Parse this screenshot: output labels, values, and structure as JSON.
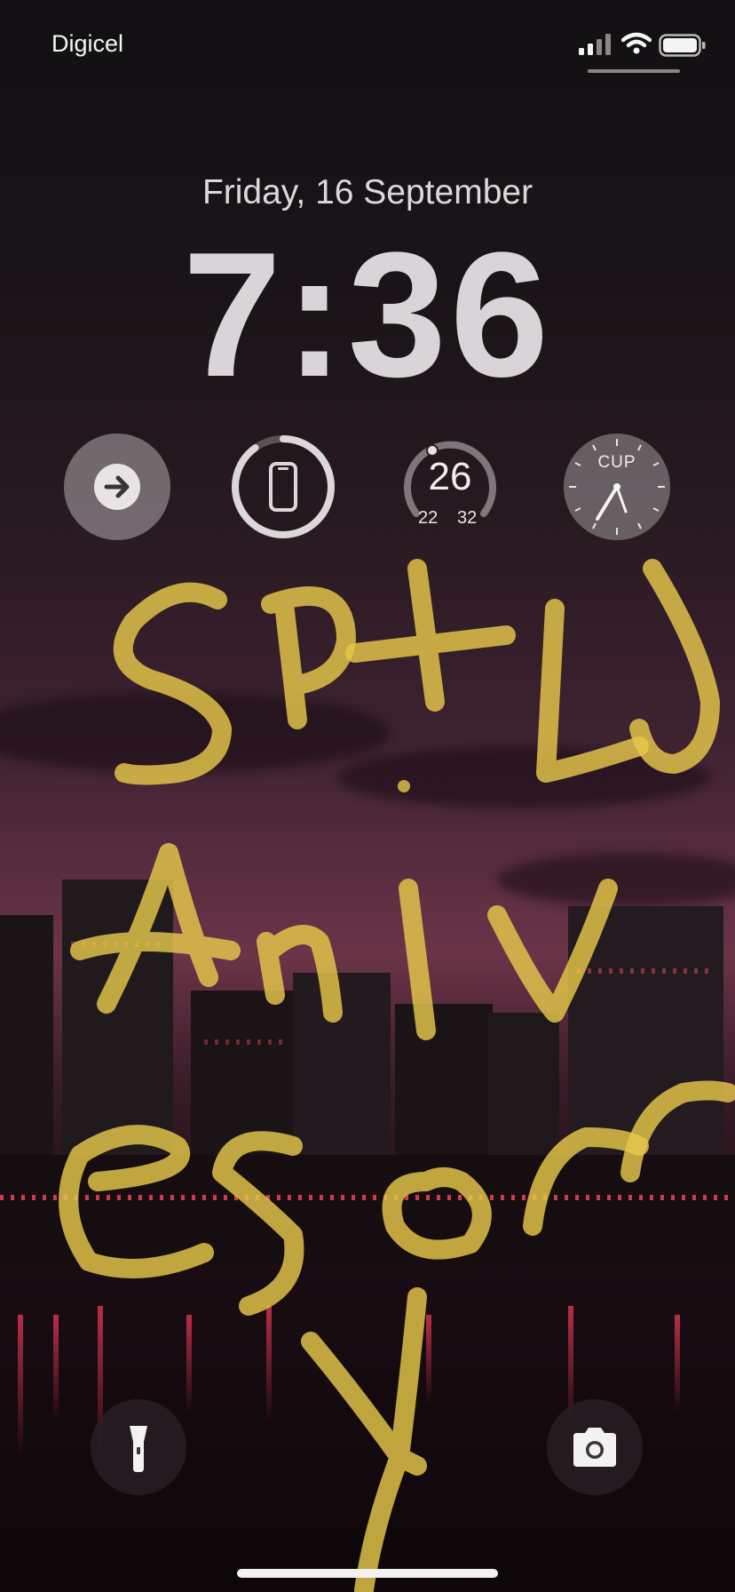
{
  "status_bar": {
    "carrier": "Digicel",
    "signal_icon": "cellular-signal-icon",
    "wifi_icon": "wifi-icon",
    "battery_icon": "battery-icon"
  },
  "lock_screen": {
    "date": "Friday, 16 September",
    "time": "7:36"
  },
  "widgets": {
    "shortcut": {
      "icon": "arrow-right-icon"
    },
    "battery": {
      "icon": "phone-icon",
      "level_fraction": 0.9
    },
    "weather": {
      "current": "26",
      "low": "22",
      "high": "32"
    },
    "clock": {
      "label": "CUP"
    }
  },
  "quick_actions": {
    "flashlight_icon": "flashlight-icon",
    "camera_icon": "camera-icon"
  },
  "colors": {
    "scribble": "#e6c84a",
    "sky_accent": "#6b3448"
  }
}
